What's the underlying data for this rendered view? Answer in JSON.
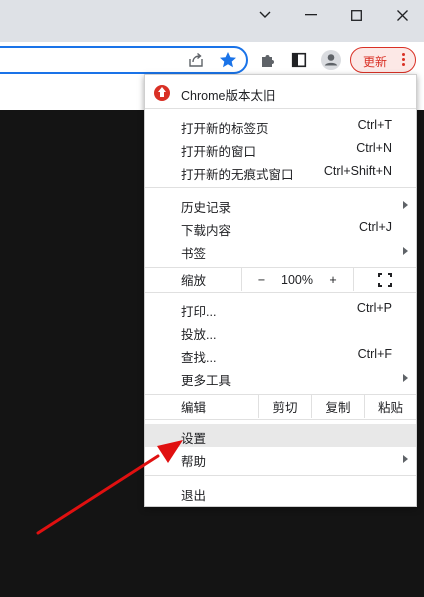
{
  "window": {
    "title": "",
    "controls": {
      "tabs_dropdown": "chevron-down-icon",
      "minimize": "minimize-icon",
      "maximize": "maximize-icon",
      "close": "close-icon"
    }
  },
  "toolbar": {
    "share_icon": "share-icon",
    "bookmark_icon": "star-icon",
    "extensions_icon": "puzzle-icon",
    "side_panel_icon": "side-panel-icon",
    "profile_icon": "avatar-icon",
    "update_label": "更新",
    "menu_icon": "kebab-menu-icon"
  },
  "menu": {
    "update_notice": "Chrome版本太旧",
    "new_tab": {
      "label": "打开新的标签页",
      "shortcut": "Ctrl+T"
    },
    "new_window": {
      "label": "打开新的窗口",
      "shortcut": "Ctrl+N"
    },
    "incognito": {
      "label": "打开新的无痕式窗口",
      "shortcut": "Ctrl+Shift+N"
    },
    "history": {
      "label": "历史记录"
    },
    "downloads": {
      "label": "下载内容",
      "shortcut": "Ctrl+J"
    },
    "bookmarks": {
      "label": "书签"
    },
    "zoom": {
      "label": "缩放",
      "minus": "−",
      "level": "100%",
      "plus": "+"
    },
    "print": {
      "label": "打印...",
      "shortcut": "Ctrl+P"
    },
    "cast": {
      "label": "投放..."
    },
    "find": {
      "label": "查找...",
      "shortcut": "Ctrl+F"
    },
    "more_tools": {
      "label": "更多工具"
    },
    "edit": {
      "label": "编辑",
      "cut": "剪切",
      "copy": "复制",
      "paste": "粘贴"
    },
    "settings": {
      "label": "设置"
    },
    "help": {
      "label": "帮助"
    },
    "exit": {
      "label": "退出"
    }
  },
  "annotation": {
    "arrow_color": "#e01010",
    "points_to": "settings"
  }
}
